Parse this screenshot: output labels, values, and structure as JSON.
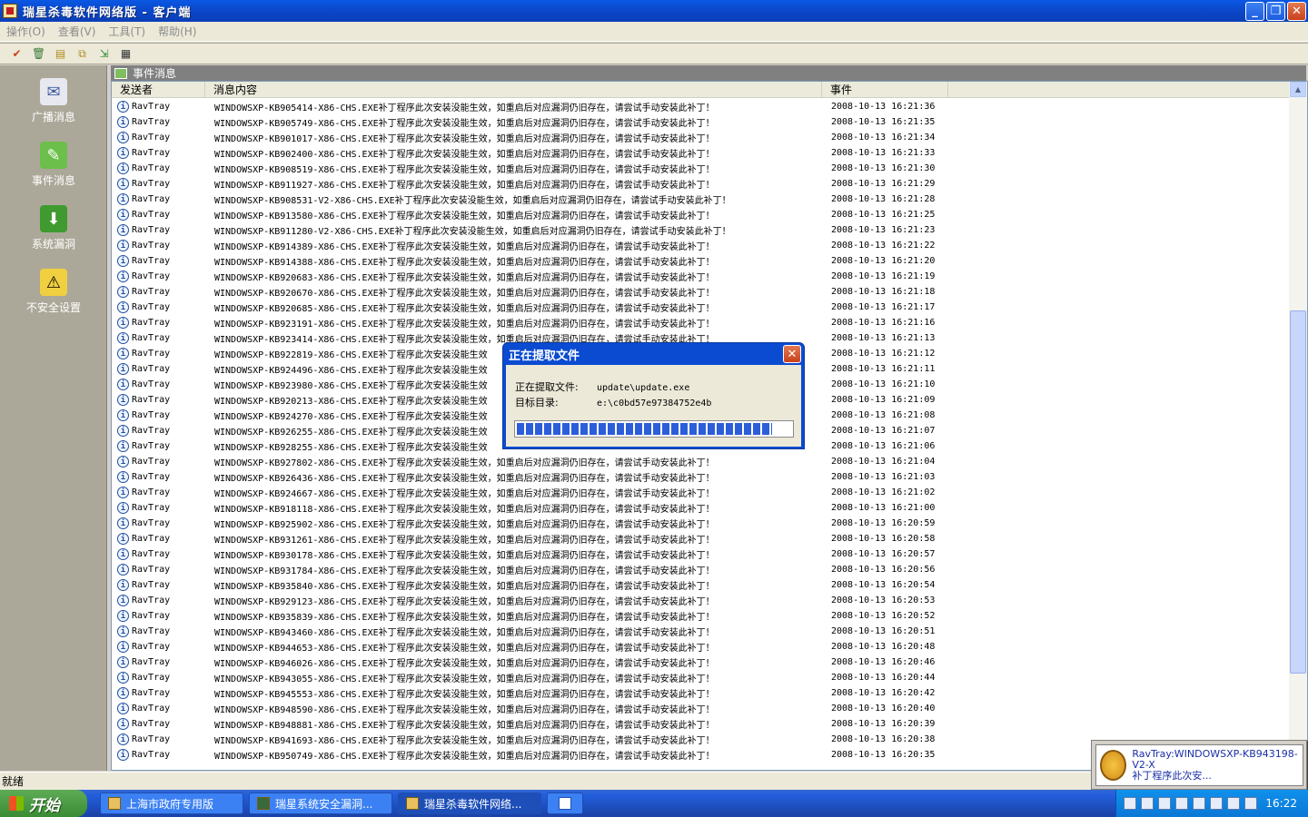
{
  "window": {
    "title": "瑞星杀毒软件网络版 - 客户端"
  },
  "menu": [
    "操作(O)",
    "查看(V)",
    "工具(T)",
    "帮助(H)"
  ],
  "sidebar": [
    {
      "label": "广播消息",
      "icon": "broadcast-icon"
    },
    {
      "label": "事件消息",
      "icon": "event-icon"
    },
    {
      "label": "系统漏洞",
      "icon": "vulnerability-icon"
    },
    {
      "label": "不安全设置",
      "icon": "unsafe-settings-icon"
    }
  ],
  "panel": {
    "title": "事件消息"
  },
  "columns": {
    "sender": "发送者",
    "content": "消息内容",
    "time": "事件"
  },
  "rows": [
    {
      "sender": "RavTray",
      "content": "WINDOWSXP-KB905414-X86-CHS.EXE补丁程序此次安装没能生效，如重启后对应漏洞仍旧存在，请尝试手动安装此补丁！",
      "time": "2008-10-13 16:21:36"
    },
    {
      "sender": "RavTray",
      "content": "WINDOWSXP-KB905749-X86-CHS.EXE补丁程序此次安装没能生效，如重启后对应漏洞仍旧存在，请尝试手动安装此补丁！",
      "time": "2008-10-13 16:21:35"
    },
    {
      "sender": "RavTray",
      "content": "WINDOWSXP-KB901017-X86-CHS.EXE补丁程序此次安装没能生效，如重启后对应漏洞仍旧存在，请尝试手动安装此补丁！",
      "time": "2008-10-13 16:21:34"
    },
    {
      "sender": "RavTray",
      "content": "WINDOWSXP-KB902400-X86-CHS.EXE补丁程序此次安装没能生效，如重启后对应漏洞仍旧存在，请尝试手动安装此补丁！",
      "time": "2008-10-13 16:21:33"
    },
    {
      "sender": "RavTray",
      "content": "WINDOWSXP-KB908519-X86-CHS.EXE补丁程序此次安装没能生效，如重启后对应漏洞仍旧存在，请尝试手动安装此补丁！",
      "time": "2008-10-13 16:21:30"
    },
    {
      "sender": "RavTray",
      "content": "WINDOWSXP-KB911927-X86-CHS.EXE补丁程序此次安装没能生效，如重启后对应漏洞仍旧存在，请尝试手动安装此补丁！",
      "time": "2008-10-13 16:21:29"
    },
    {
      "sender": "RavTray",
      "content": "WINDOWSXP-KB908531-V2-X86-CHS.EXE补丁程序此次安装没能生效，如重启后对应漏洞仍旧存在，请尝试手动安装此补丁！",
      "time": "2008-10-13 16:21:28"
    },
    {
      "sender": "RavTray",
      "content": "WINDOWSXP-KB913580-X86-CHS.EXE补丁程序此次安装没能生效，如重启后对应漏洞仍旧存在，请尝试手动安装此补丁！",
      "time": "2008-10-13 16:21:25"
    },
    {
      "sender": "RavTray",
      "content": "WINDOWSXP-KB911280-V2-X86-CHS.EXE补丁程序此次安装没能生效，如重启后对应漏洞仍旧存在，请尝试手动安装此补丁！",
      "time": "2008-10-13 16:21:23"
    },
    {
      "sender": "RavTray",
      "content": "WINDOWSXP-KB914389-X86-CHS.EXE补丁程序此次安装没能生效，如重启后对应漏洞仍旧存在，请尝试手动安装此补丁！",
      "time": "2008-10-13 16:21:22"
    },
    {
      "sender": "RavTray",
      "content": "WINDOWSXP-KB914388-X86-CHS.EXE补丁程序此次安装没能生效，如重启后对应漏洞仍旧存在，请尝试手动安装此补丁！",
      "time": "2008-10-13 16:21:20"
    },
    {
      "sender": "RavTray",
      "content": "WINDOWSXP-KB920683-X86-CHS.EXE补丁程序此次安装没能生效，如重启后对应漏洞仍旧存在，请尝试手动安装此补丁！",
      "time": "2008-10-13 16:21:19"
    },
    {
      "sender": "RavTray",
      "content": "WINDOWSXP-KB920670-X86-CHS.EXE补丁程序此次安装没能生效，如重启后对应漏洞仍旧存在，请尝试手动安装此补丁！",
      "time": "2008-10-13 16:21:18"
    },
    {
      "sender": "RavTray",
      "content": "WINDOWSXP-KB920685-X86-CHS.EXE补丁程序此次安装没能生效，如重启后对应漏洞仍旧存在，请尝试手动安装此补丁！",
      "time": "2008-10-13 16:21:17"
    },
    {
      "sender": "RavTray",
      "content": "WINDOWSXP-KB923191-X86-CHS.EXE补丁程序此次安装没能生效，如重启后对应漏洞仍旧存在，请尝试手动安装此补丁！",
      "time": "2008-10-13 16:21:16"
    },
    {
      "sender": "RavTray",
      "content": "WINDOWSXP-KB923414-X86-CHS.EXE补丁程序此次安装没能生效，如重启后对应漏洞仍旧存在，请尝试手动安装此补丁！",
      "time": "2008-10-13 16:21:13"
    },
    {
      "sender": "RavTray",
      "content": "WINDOWSXP-KB922819-X86-CHS.EXE补丁程序此次安装没能生效",
      "time": "2008-10-13 16:21:12"
    },
    {
      "sender": "RavTray",
      "content": "WINDOWSXP-KB924496-X86-CHS.EXE补丁程序此次安装没能生效",
      "time": "2008-10-13 16:21:11"
    },
    {
      "sender": "RavTray",
      "content": "WINDOWSXP-KB923980-X86-CHS.EXE补丁程序此次安装没能生效",
      "time": "2008-10-13 16:21:10"
    },
    {
      "sender": "RavTray",
      "content": "WINDOWSXP-KB920213-X86-CHS.EXE补丁程序此次安装没能生效",
      "time": "2008-10-13 16:21:09"
    },
    {
      "sender": "RavTray",
      "content": "WINDOWSXP-KB924270-X86-CHS.EXE补丁程序此次安装没能生效",
      "time": "2008-10-13 16:21:08"
    },
    {
      "sender": "RavTray",
      "content": "WINDOWSXP-KB926255-X86-CHS.EXE补丁程序此次安装没能生效",
      "time": "2008-10-13 16:21:07"
    },
    {
      "sender": "RavTray",
      "content": "WINDOWSXP-KB928255-X86-CHS.EXE补丁程序此次安装没能生效",
      "time": "2008-10-13 16:21:06"
    },
    {
      "sender": "RavTray",
      "content": "WINDOWSXP-KB927802-X86-CHS.EXE补丁程序此次安装没能生效，如重启后对应漏洞仍旧存在，请尝试手动安装此补丁！",
      "time": "2008-10-13 16:21:04"
    },
    {
      "sender": "RavTray",
      "content": "WINDOWSXP-KB926436-X86-CHS.EXE补丁程序此次安装没能生效，如重启后对应漏洞仍旧存在，请尝试手动安装此补丁！",
      "time": "2008-10-13 16:21:03"
    },
    {
      "sender": "RavTray",
      "content": "WINDOWSXP-KB924667-X86-CHS.EXE补丁程序此次安装没能生效，如重启后对应漏洞仍旧存在，请尝试手动安装此补丁！",
      "time": "2008-10-13 16:21:02"
    },
    {
      "sender": "RavTray",
      "content": "WINDOWSXP-KB918118-X86-CHS.EXE补丁程序此次安装没能生效，如重启后对应漏洞仍旧存在，请尝试手动安装此补丁！",
      "time": "2008-10-13 16:21:00"
    },
    {
      "sender": "RavTray",
      "content": "WINDOWSXP-KB925902-X86-CHS.EXE补丁程序此次安装没能生效，如重启后对应漏洞仍旧存在，请尝试手动安装此补丁！",
      "time": "2008-10-13 16:20:59"
    },
    {
      "sender": "RavTray",
      "content": "WINDOWSXP-KB931261-X86-CHS.EXE补丁程序此次安装没能生效，如重启后对应漏洞仍旧存在，请尝试手动安装此补丁！",
      "time": "2008-10-13 16:20:58"
    },
    {
      "sender": "RavTray",
      "content": "WINDOWSXP-KB930178-X86-CHS.EXE补丁程序此次安装没能生效，如重启后对应漏洞仍旧存在，请尝试手动安装此补丁！",
      "time": "2008-10-13 16:20:57"
    },
    {
      "sender": "RavTray",
      "content": "WINDOWSXP-KB931784-X86-CHS.EXE补丁程序此次安装没能生效，如重启后对应漏洞仍旧存在，请尝试手动安装此补丁！",
      "time": "2008-10-13 16:20:56"
    },
    {
      "sender": "RavTray",
      "content": "WINDOWSXP-KB935840-X86-CHS.EXE补丁程序此次安装没能生效，如重启后对应漏洞仍旧存在，请尝试手动安装此补丁！",
      "time": "2008-10-13 16:20:54"
    },
    {
      "sender": "RavTray",
      "content": "WINDOWSXP-KB929123-X86-CHS.EXE补丁程序此次安装没能生效，如重启后对应漏洞仍旧存在，请尝试手动安装此补丁！",
      "time": "2008-10-13 16:20:53"
    },
    {
      "sender": "RavTray",
      "content": "WINDOWSXP-KB935839-X86-CHS.EXE补丁程序此次安装没能生效，如重启后对应漏洞仍旧存在，请尝试手动安装此补丁！",
      "time": "2008-10-13 16:20:52"
    },
    {
      "sender": "RavTray",
      "content": "WINDOWSXP-KB943460-X86-CHS.EXE补丁程序此次安装没能生效，如重启后对应漏洞仍旧存在，请尝试手动安装此补丁！",
      "time": "2008-10-13 16:20:51"
    },
    {
      "sender": "RavTray",
      "content": "WINDOWSXP-KB944653-X86-CHS.EXE补丁程序此次安装没能生效，如重启后对应漏洞仍旧存在，请尝试手动安装此补丁！",
      "time": "2008-10-13 16:20:48"
    },
    {
      "sender": "RavTray",
      "content": "WINDOWSXP-KB946026-X86-CHS.EXE补丁程序此次安装没能生效，如重启后对应漏洞仍旧存在，请尝试手动安装此补丁！",
      "time": "2008-10-13 16:20:46"
    },
    {
      "sender": "RavTray",
      "content": "WINDOWSXP-KB943055-X86-CHS.EXE补丁程序此次安装没能生效，如重启后对应漏洞仍旧存在，请尝试手动安装此补丁！",
      "time": "2008-10-13 16:20:44"
    },
    {
      "sender": "RavTray",
      "content": "WINDOWSXP-KB945553-X86-CHS.EXE补丁程序此次安装没能生效，如重启后对应漏洞仍旧存在，请尝试手动安装此补丁！",
      "time": "2008-10-13 16:20:42"
    },
    {
      "sender": "RavTray",
      "content": "WINDOWSXP-KB948590-X86-CHS.EXE补丁程序此次安装没能生效，如重启后对应漏洞仍旧存在，请尝试手动安装此补丁！",
      "time": "2008-10-13 16:20:40"
    },
    {
      "sender": "RavTray",
      "content": "WINDOWSXP-KB948881-X86-CHS.EXE补丁程序此次安装没能生效，如重启后对应漏洞仍旧存在，请尝试手动安装此补丁！",
      "time": "2008-10-13 16:20:39"
    },
    {
      "sender": "RavTray",
      "content": "WINDOWSXP-KB941693-X86-CHS.EXE补丁程序此次安装没能生效，如重启后对应漏洞仍旧存在，请尝试手动安装此补丁！",
      "time": "2008-10-13 16:20:38"
    },
    {
      "sender": "RavTray",
      "content": "WINDOWSXP-KB950749-X86-CHS.EXE补丁程序此次安装没能生效，如重启后对应漏洞仍旧存在，请尝试手动安装此补丁！",
      "time": "2008-10-13 16:20:35"
    }
  ],
  "dialog": {
    "title": "正在提取文件",
    "file_label": "正在提取文件:",
    "file_value": "update\\update.exe",
    "dir_label": "目标目录:",
    "dir_value": "e:\\c0bd57e97384752e4b",
    "progress": 0.93
  },
  "status": "就绪",
  "balloon": {
    "line1": "RavTray:WINDOWSXP-KB943198-V2-X",
    "line2": "补丁程序此次安..."
  },
  "taskbar": {
    "start": "开始",
    "tasks": [
      "上海市政府专用版",
      "瑞星系统安全漏洞...",
      "瑞星杀毒软件网络..."
    ],
    "clock": "16:22"
  }
}
